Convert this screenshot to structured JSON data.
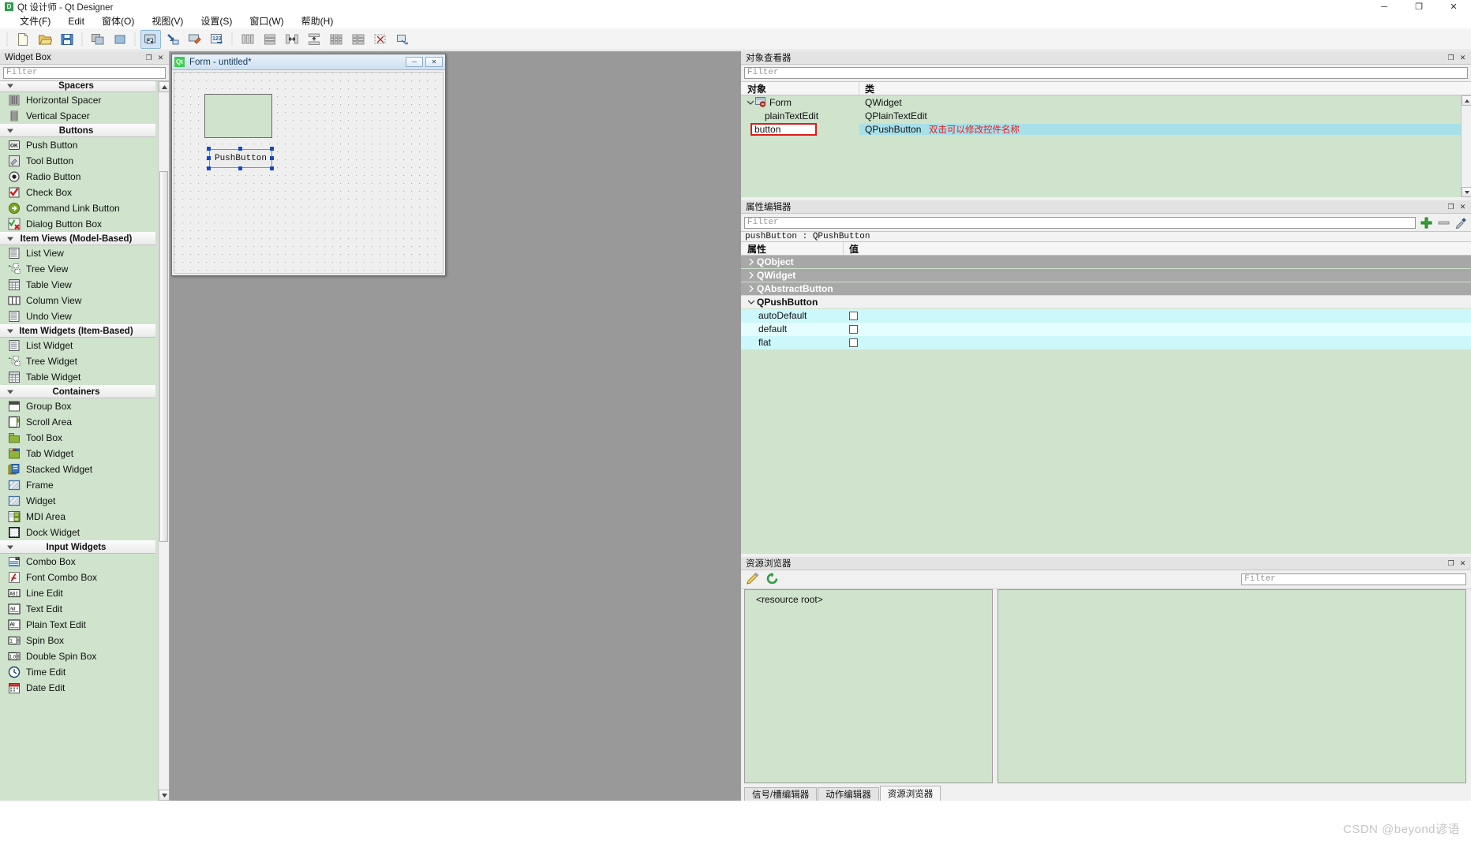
{
  "titlebar": {
    "icon": "designer-app-icon",
    "title": "Qt 设计师 - Qt Designer",
    "minimize": "─",
    "maximize": "❐",
    "close": "✕"
  },
  "menubar": {
    "items": [
      {
        "label": "文件(F)",
        "name": "menu-file"
      },
      {
        "label": "Edit",
        "name": "menu-edit"
      },
      {
        "label": "窗体(O)",
        "name": "menu-form"
      },
      {
        "label": "视图(V)",
        "name": "menu-view"
      },
      {
        "label": "设置(S)",
        "name": "menu-settings"
      },
      {
        "label": "窗口(W)",
        "name": "menu-window"
      },
      {
        "label": "帮助(H)",
        "name": "menu-help"
      }
    ]
  },
  "toolbar": {
    "groups": [
      [
        "new-file-icon",
        "open-file-icon",
        "save-file-icon"
      ],
      [
        "undo-icon",
        "redo-icon"
      ],
      [
        "edit-widgets-icon",
        "edit-signals-slots-icon",
        "edit-buddies-icon",
        "edit-tab-order-icon"
      ],
      [
        "layout-horizontally-icon",
        "layout-vertically-icon",
        "layout-splitter-horizontal-icon",
        "layout-splitter-vertical-icon",
        "layout-grid-icon",
        "layout-form-icon",
        "break-layout-icon",
        "adjust-size-icon"
      ]
    ]
  },
  "widgetbox": {
    "title": "Widget Box",
    "float_btn": "❐",
    "close_btn": "✕",
    "filter_placeholder": "Filter",
    "scroll_up": "▲",
    "scroll_down": "▼",
    "sections": [
      {
        "name": "Spacers",
        "items": [
          {
            "label": "Horizontal Spacer",
            "icon": "horizontal-spacer-icon"
          },
          {
            "label": "Vertical Spacer",
            "icon": "vertical-spacer-icon"
          }
        ]
      },
      {
        "name": "Buttons",
        "items": [
          {
            "label": "Push Button",
            "icon": "push-button-icon"
          },
          {
            "label": "Tool Button",
            "icon": "tool-button-icon"
          },
          {
            "label": "Radio Button",
            "icon": "radio-button-icon"
          },
          {
            "label": "Check Box",
            "icon": "check-box-icon"
          },
          {
            "label": "Command Link Button",
            "icon": "command-link-button-icon"
          },
          {
            "label": "Dialog Button Box",
            "icon": "dialog-button-box-icon"
          }
        ]
      },
      {
        "name": "Item Views (Model-Based)",
        "items": [
          {
            "label": "List View",
            "icon": "list-view-icon"
          },
          {
            "label": "Tree View",
            "icon": "tree-view-icon"
          },
          {
            "label": "Table View",
            "icon": "table-view-icon"
          },
          {
            "label": "Column View",
            "icon": "column-view-icon"
          },
          {
            "label": "Undo View",
            "icon": "undo-view-icon"
          }
        ]
      },
      {
        "name": "Item Widgets (Item-Based)",
        "items": [
          {
            "label": "List Widget",
            "icon": "list-widget-icon"
          },
          {
            "label": "Tree Widget",
            "icon": "tree-widget-icon"
          },
          {
            "label": "Table Widget",
            "icon": "table-widget-icon"
          }
        ]
      },
      {
        "name": "Containers",
        "items": [
          {
            "label": "Group Box",
            "icon": "group-box-icon"
          },
          {
            "label": "Scroll Area",
            "icon": "scroll-area-icon"
          },
          {
            "label": "Tool Box",
            "icon": "tool-box-icon"
          },
          {
            "label": "Tab Widget",
            "icon": "tab-widget-icon"
          },
          {
            "label": "Stacked Widget",
            "icon": "stacked-widget-icon"
          },
          {
            "label": "Frame",
            "icon": "frame-icon"
          },
          {
            "label": "Widget",
            "icon": "widget-icon"
          },
          {
            "label": "MDI Area",
            "icon": "mdi-area-icon"
          },
          {
            "label": "Dock Widget",
            "icon": "dock-widget-icon"
          }
        ]
      },
      {
        "name": "Input Widgets",
        "items": [
          {
            "label": "Combo Box",
            "icon": "combo-box-icon"
          },
          {
            "label": "Font Combo Box",
            "icon": "font-combo-box-icon"
          },
          {
            "label": "Line Edit",
            "icon": "line-edit-icon"
          },
          {
            "label": "Text Edit",
            "icon": "text-edit-icon"
          },
          {
            "label": "Plain Text Edit",
            "icon": "plain-text-edit-icon"
          },
          {
            "label": "Spin Box",
            "icon": "spin-box-icon"
          },
          {
            "label": "Double Spin Box",
            "icon": "double-spin-box-icon"
          },
          {
            "label": "Time Edit",
            "icon": "time-edit-icon"
          },
          {
            "label": "Date Edit",
            "icon": "date-edit-icon"
          }
        ]
      }
    ]
  },
  "formwindow": {
    "icon": "qt-logo-icon",
    "title": "Form - untitled*",
    "minimize": "─",
    "close": "✕",
    "widgets": {
      "plain_text_edit": "",
      "push_button_label": "PushButton"
    }
  },
  "objectinspector": {
    "title": "对象查看器",
    "float_btn": "❐",
    "close_btn": "✕",
    "filter_placeholder": "Filter",
    "columns": [
      "对象",
      "类"
    ],
    "rows": [
      {
        "object": "Form",
        "class": "QWidget",
        "level": 0,
        "expanded": true,
        "icon": "form-icon"
      },
      {
        "object": "plainTextEdit",
        "class": "QPlainTextEdit",
        "level": 1
      },
      {
        "object": "button",
        "class": "QPushButton",
        "level": 1,
        "editing": true,
        "selected": true
      }
    ],
    "annotation": "双击可以修改控件名称",
    "annotation_color": "#e01b1b"
  },
  "propertyeditor": {
    "title": "属性编辑器",
    "float_btn": "❐",
    "close_btn": "✕",
    "filter_placeholder": "Filter",
    "add_btn": "add-property-icon",
    "remove_btn": "remove-property-icon",
    "config_btn": "configure-icon",
    "selection": "pushButton : QPushButton",
    "columns": [
      "属性",
      "值"
    ],
    "groups": [
      {
        "name": "QObject",
        "expanded": false,
        "style": "dark"
      },
      {
        "name": "QWidget",
        "expanded": false,
        "style": "dark"
      },
      {
        "name": "QAbstractButton",
        "expanded": false,
        "style": "dark"
      },
      {
        "name": "QPushButton",
        "expanded": true,
        "style": "light",
        "rows": [
          {
            "property": "autoDefault",
            "value": "unchecked"
          },
          {
            "property": "default",
            "value": "unchecked"
          },
          {
            "property": "flat",
            "value": "unchecked"
          }
        ]
      }
    ]
  },
  "resourcebrowser": {
    "title": "资源浏览器",
    "float_btn": "❐",
    "close_btn": "✕",
    "edit_btn": "pencil-edit-icon",
    "reload_btn": "reload-refresh-icon",
    "filter_placeholder": "Filter",
    "root_item": "<resource root>",
    "tabs": [
      {
        "label": "信号/槽编辑器",
        "active": false
      },
      {
        "label": "动作编辑器",
        "active": false
      },
      {
        "label": "资源浏览器",
        "active": true
      }
    ]
  },
  "watermark": {
    "text": "CSDN @beyond谚语"
  },
  "colors": {
    "widget_list_bg": "#cfe3cd",
    "selected_row": "#a8e0ea",
    "property_row": "#ccf7fb",
    "annotation_red": "#e01b1b",
    "workspace_gray": "#999999",
    "selection_handle": "#1448c8"
  }
}
